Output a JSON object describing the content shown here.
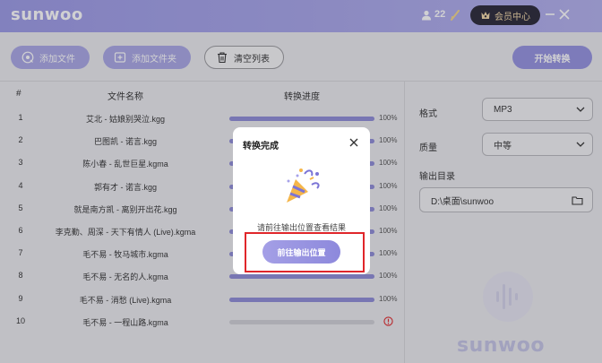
{
  "app": {
    "brand": "sunwoo",
    "points": "22",
    "vip_label": "会员中心"
  },
  "toolbar": {
    "add_file": "添加文件",
    "add_folder": "添加文件夹",
    "clear_list": "清空列表",
    "start": "开始转换"
  },
  "table": {
    "headers": {
      "index": "#",
      "name": "文件名称",
      "progress": "转换进度"
    },
    "rows": [
      {
        "index": "1",
        "name": "艾北 - 姑娘别哭泣.kgg",
        "progress": 1.0,
        "pct": "100%"
      },
      {
        "index": "2",
        "name": "巴图凯 - 诺言.kgg",
        "progress": 1.0,
        "pct": "100%"
      },
      {
        "index": "3",
        "name": "陈小春 - 乱世巨星.kgma",
        "progress": 1.0,
        "pct": "100%"
      },
      {
        "index": "4",
        "name": "郭有才 - 诺言.kgg",
        "progress": 1.0,
        "pct": "100%"
      },
      {
        "index": "5",
        "name": "就是南方凯 - 离别开出花.kgg",
        "progress": 1.0,
        "pct": "100%"
      },
      {
        "index": "6",
        "name": "李克勤、周深 - 天下有情人 (Live).kgma",
        "progress": 1.0,
        "pct": "100%"
      },
      {
        "index": "7",
        "name": "毛不易 - 牧马城市.kgma",
        "progress": 1.0,
        "pct": "100%"
      },
      {
        "index": "8",
        "name": "毛不易 - 无名的人.kgma",
        "progress": 1.0,
        "pct": "100%"
      },
      {
        "index": "9",
        "name": "毛不易 - 消愁 (Live).kgma",
        "progress": 1.0,
        "pct": "100%"
      },
      {
        "index": "10",
        "name": "毛不易 - 一程山路.kgma",
        "progress": 0.0,
        "pct": "",
        "error": true
      }
    ]
  },
  "settings": {
    "format_label": "格式",
    "format_value": "MP3",
    "quality_label": "质量",
    "quality_value": "中等",
    "output_label": "输出目录",
    "output_path": "D:\\桌面\\sunwoo",
    "watermark": "sunwoo"
  },
  "modal": {
    "title": "转换完成",
    "message": "请前往输出位置查看结果",
    "button": "前往输出位置"
  },
  "colors": {
    "accent": "#9593e0",
    "progress": "#8f8cd8",
    "error": "#e0262a",
    "vip_bg": "#2a2838"
  }
}
